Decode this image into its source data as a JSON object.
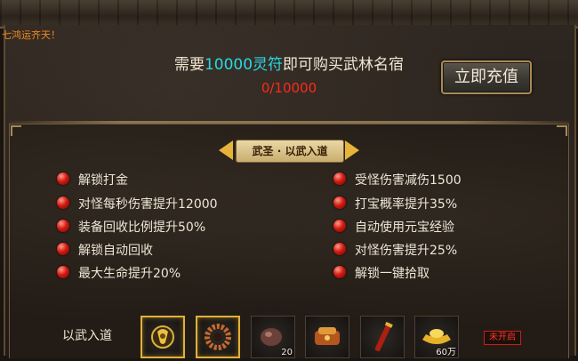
{
  "ticker": {
    "text": "七鸿运齐天！"
  },
  "header": {
    "text_before": "需要",
    "highlight": "10000灵符",
    "text_after": "即可购买武林名宿",
    "progress": "0/10000",
    "recharge_label": "立即充值",
    "highlight_color": "#29d8e6",
    "progress_color": "#ff2a1a"
  },
  "tier": {
    "title": "武圣 · 以武入道"
  },
  "features_left": [
    "解锁打金",
    "对怪每秒伤害提升12000",
    "装备回收比例提升50%",
    "解锁自动回收",
    "最大生命提升20%"
  ],
  "features_right": [
    "受怪伤害减伤1500",
    "打宝概率提升35%",
    "自动使用元宝经验",
    "对怪伤害提升25%",
    "解锁一键拾取"
  ],
  "rewards": {
    "label": "以武入道",
    "items": [
      {
        "icon": "gold-emblem-icon",
        "count": ""
      },
      {
        "icon": "bead-ring-icon",
        "count": ""
      },
      {
        "icon": "ore-stone-icon",
        "count": "20"
      },
      {
        "icon": "treasure-bundle-icon",
        "count": ""
      },
      {
        "icon": "red-scroll-icon",
        "count": ""
      },
      {
        "icon": "gold-ingot-icon",
        "count": "60万"
      }
    ],
    "status": "未开启"
  }
}
